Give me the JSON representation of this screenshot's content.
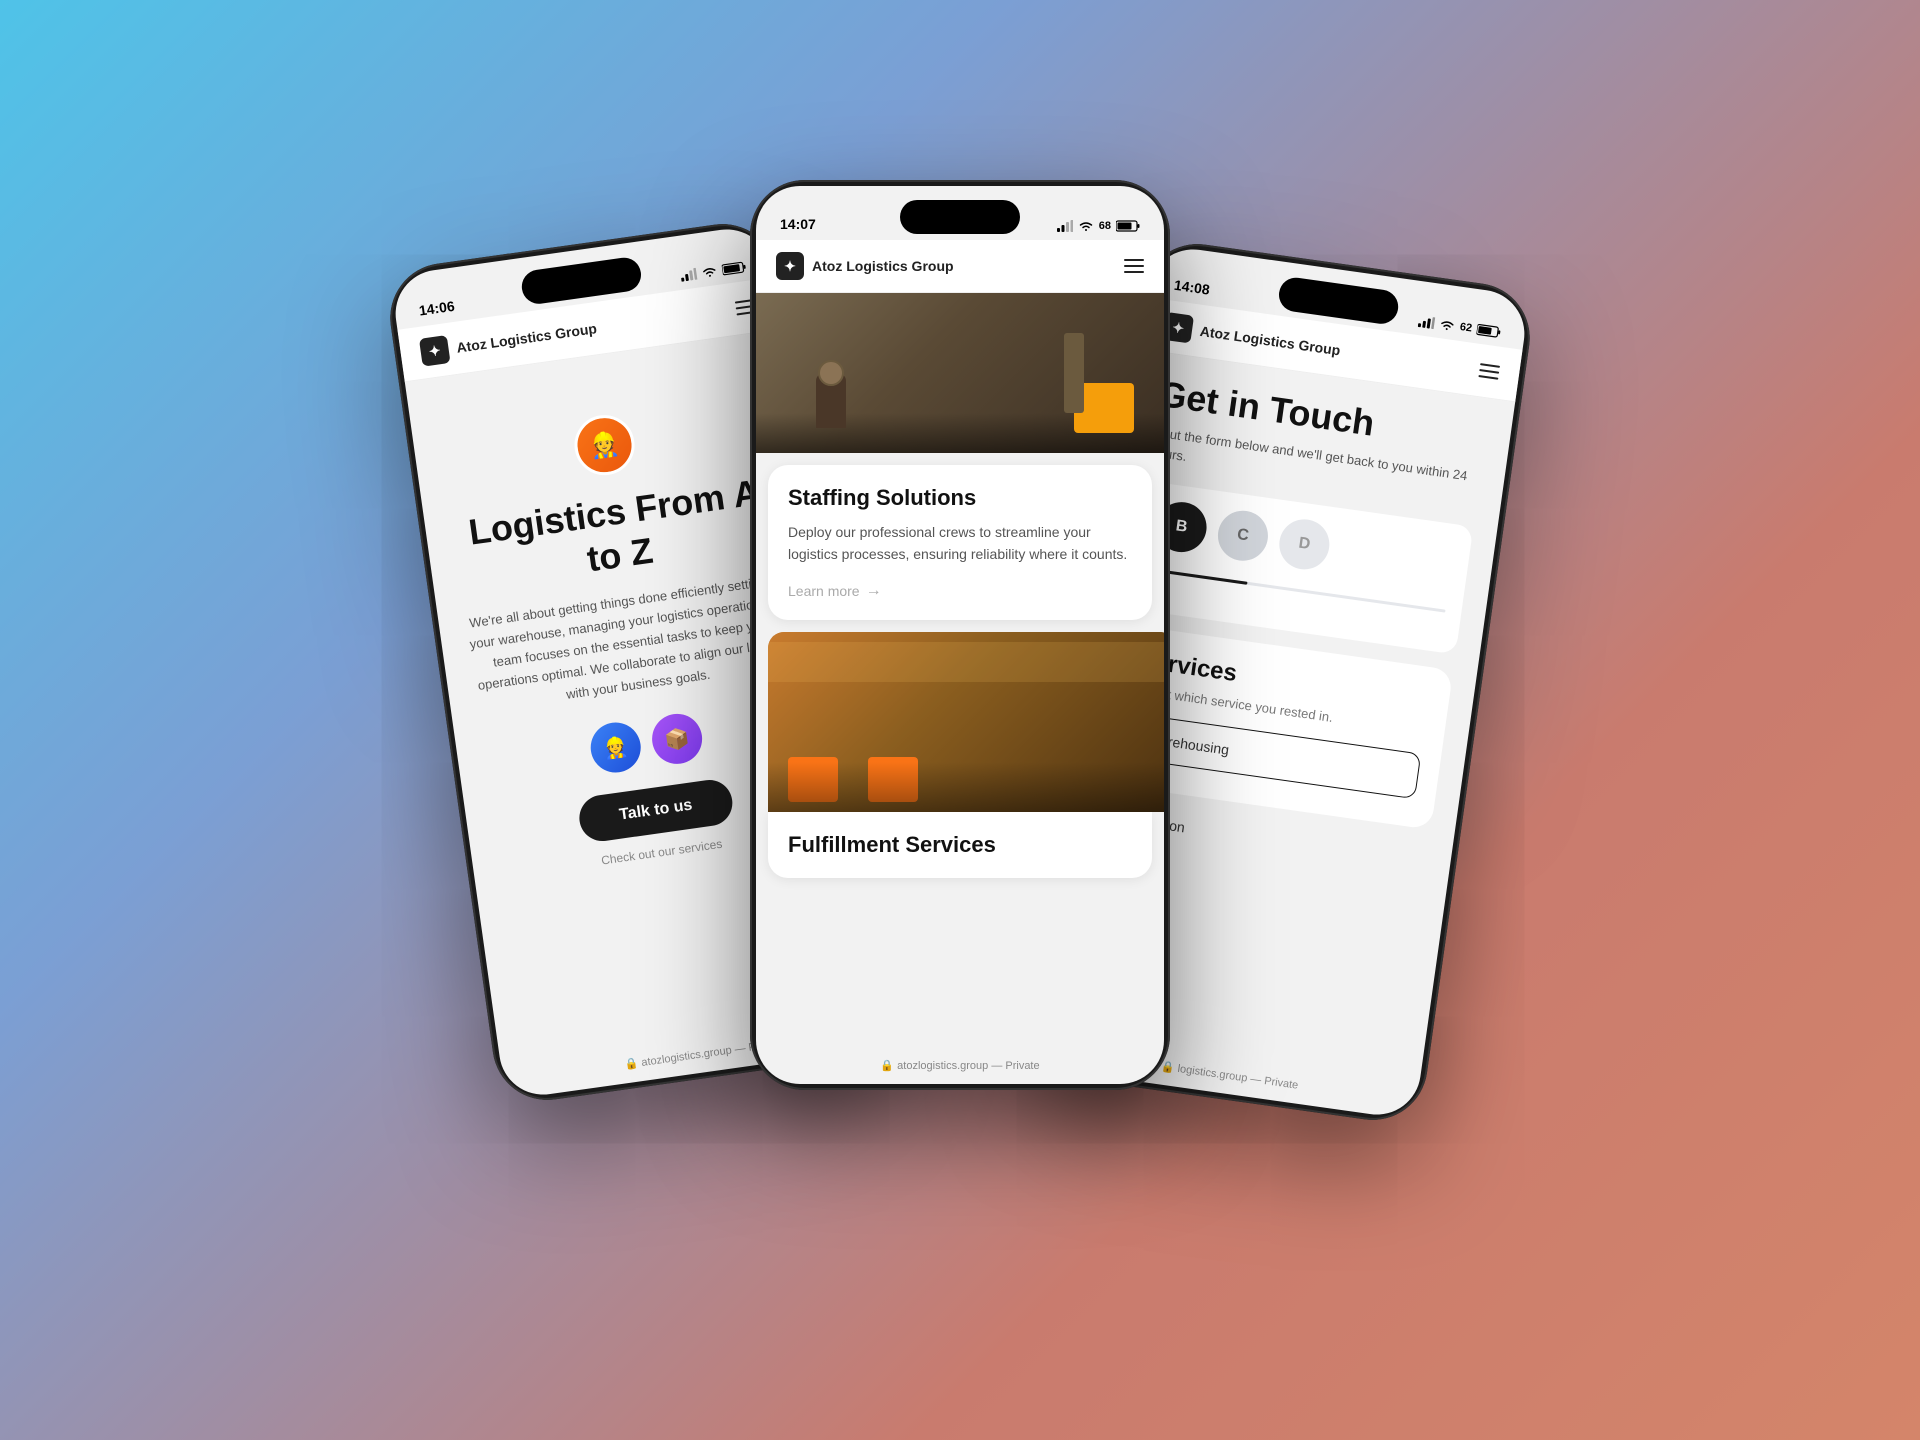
{
  "background": {
    "gradient_start": "#4fc3e8",
    "gradient_end": "#d4856a"
  },
  "left_phone": {
    "status_time": "14:06",
    "app_name": "Atoz Logistics Group",
    "hero_title": "Logistics From A to Z",
    "hero_subtitle": "We're all about getting things done efficiently setting up your warehouse, managing your logistics operations our team focuses on the essential tasks to keep your operations optimal. We collaborate to align our logistics with your business goals.",
    "cta_button": "Talk to us",
    "check_services": "Check out our services",
    "url": "atozlogistics.group — P"
  },
  "center_phone": {
    "status_time": "14:07",
    "app_name": "Atoz Logistics Group",
    "service1_title": "Staffing Solutions",
    "service1_desc": "Deploy our professional crews to streamline your logistics processes, ensuring reliability where it counts.",
    "learn_more": "Learn more",
    "service2_title": "Fulfillment Services",
    "url": "atozlogistics.group — Private"
  },
  "right_phone": {
    "status_time": "14:08",
    "app_name": "Atoz Logistics Group",
    "contact_title": "Get in Touch",
    "contact_subtitle": "ll out the form below and we'll get back to you within 24 hours.",
    "avatar_b": "B",
    "avatar_c": "C",
    "avatar_d": "D",
    "services_heading": "services",
    "services_prompt": "select which service you rested in.",
    "option_warehousing": "Warehousing",
    "option_distribution": "Distribution",
    "url": "logistics.group — Private"
  }
}
